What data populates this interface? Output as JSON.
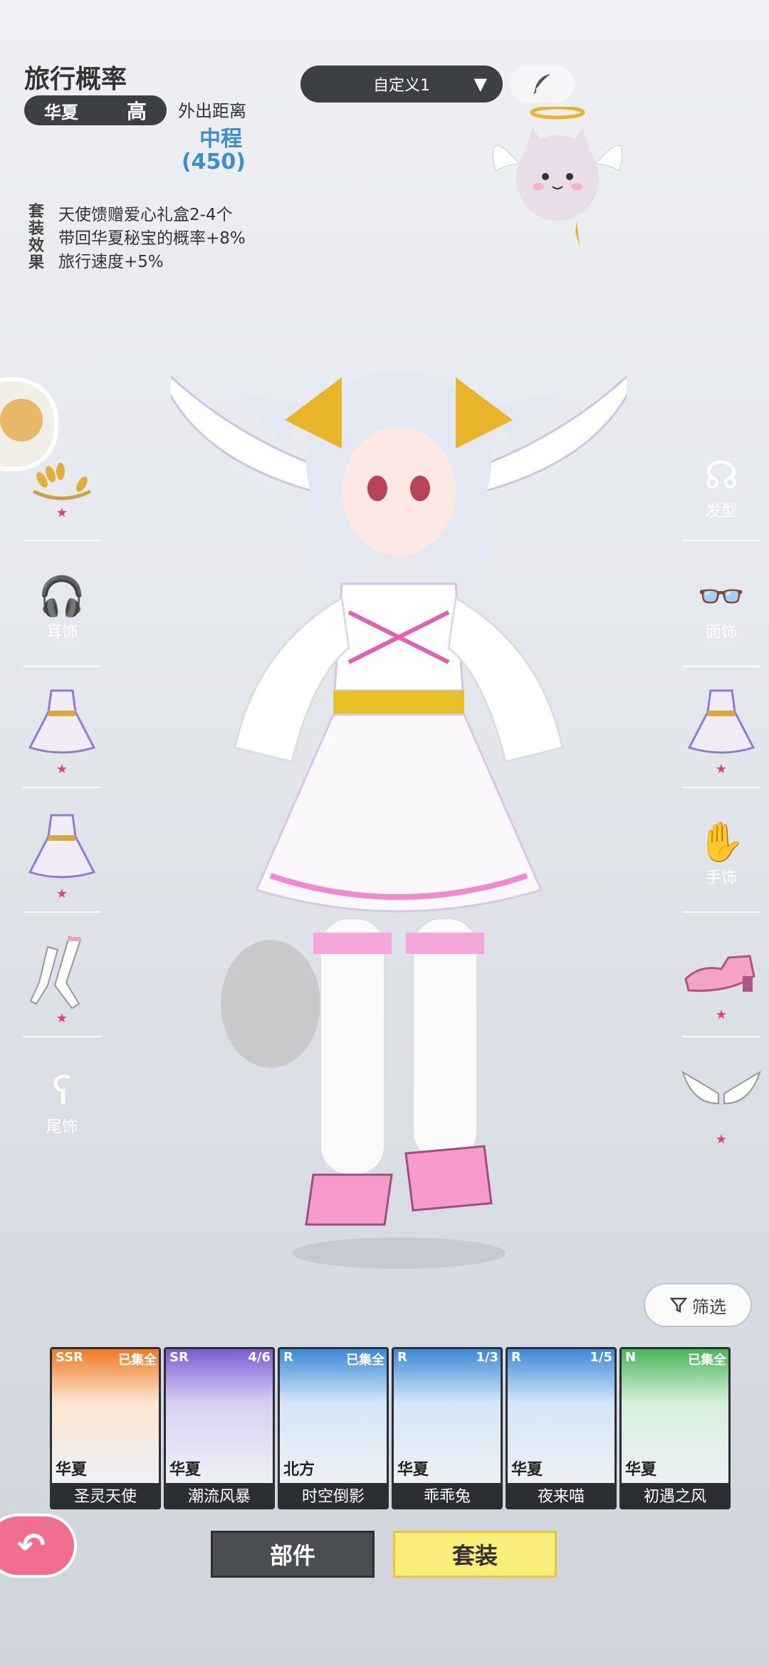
{
  "info": {
    "title": "旅行概率",
    "region": "华夏",
    "level": "高",
    "distance_label": "外出距离",
    "distance_value": "中程",
    "distance_num": "(450)",
    "effect_tag": "套装效果",
    "effects": [
      "天使馈赠爱心礼盒2-4个",
      "带回华夏秘宝的概率+8%",
      "旅行速度+5%"
    ]
  },
  "preset": {
    "label": "自定义1",
    "arrow": "▼"
  },
  "left_slots": {
    "earring": "耳饰",
    "tail": "尾饰"
  },
  "right_slots": {
    "hair": "发型",
    "face": "面饰",
    "hand": "手饰"
  },
  "filter_label": "筛选",
  "cards": [
    {
      "rarity": "SSR",
      "status": "已集全",
      "region": "华夏",
      "name": "圣灵天使",
      "color": "#f07a25"
    },
    {
      "rarity": "SR",
      "status": "4/6",
      "region": "华夏",
      "name": "潮流风暴",
      "color": "#7b5bd6"
    },
    {
      "rarity": "R",
      "status": "已集全",
      "region": "北方",
      "name": "时空倒影",
      "color": "#3c88d8"
    },
    {
      "rarity": "R",
      "status": "1/3",
      "region": "华夏",
      "name": "乖乖兔",
      "color": "#3c88d8"
    },
    {
      "rarity": "R",
      "status": "1/5",
      "region": "华夏",
      "name": "夜来喵",
      "color": "#3c88d8"
    },
    {
      "rarity": "N",
      "status": "已集全",
      "region": "华夏",
      "name": "初遇之风",
      "color": "#47b65a"
    }
  ],
  "tabs": {
    "parts": "部件",
    "sets": "套装"
  },
  "colors": {
    "accent_blue": "#3f8fd0",
    "star_pink": "#ee3d6b",
    "tab_yellow": "#f9ee7a"
  }
}
